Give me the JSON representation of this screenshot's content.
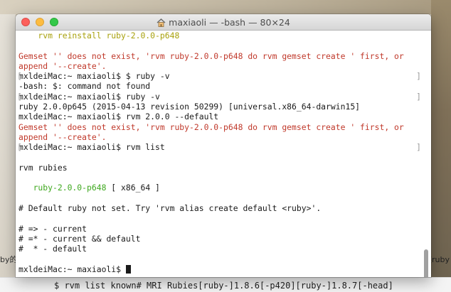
{
  "desktop": {
    "left_fragment": "by的",
    "right_fragment": "装ruby",
    "bottom_text": "$ rvm list known# MRI Rubies[ruby-]1.8.6[-p420][ruby-]1.8.7[-head]"
  },
  "window": {
    "title": "maxiaoli — -bash — 80×24"
  },
  "terminal": {
    "l1": "    rvm reinstall ruby-2.0.0-p648",
    "l2": "",
    "l3a": "Gemset '' does not exist, 'rvm ruby-2.0.0-p648 do rvm gemset create ' first, or",
    "l3b": "append '--create'.",
    "l4": "mxldeiMac:~ maxiaoli$ $ ruby -v",
    "l5": "-bash: $: command not found",
    "l6": "mxldeiMac:~ maxiaoli$ ruby -v",
    "l7": "ruby 2.0.0p645 (2015-04-13 revision 50299) [universal.x86_64-darwin15]",
    "l8": "mxldeiMac:~ maxiaoli$ rvm 2.0.0 --default",
    "l9a": "Gemset '' does not exist, 'rvm ruby-2.0.0-p648 do rvm gemset create ' first, or",
    "l9b": "append '--create'.",
    "l10": "mxldeiMac:~ maxiaoli$ rvm list",
    "l11": "",
    "l12": "rvm rubies",
    "l13": "",
    "l14_ruby": "   ruby-2.0.0-p648",
    "l14_arch": " [ x86_64 ]",
    "l15": "",
    "l16": "# Default ruby not set. Try 'rvm alias create default <ruby>'.",
    "l17": "",
    "l18": "# => - current",
    "l19": "# =* - current && default",
    "l20": "#  * - default",
    "l21": "",
    "prompt": "mxldeiMac:~ maxiaoli$ "
  }
}
